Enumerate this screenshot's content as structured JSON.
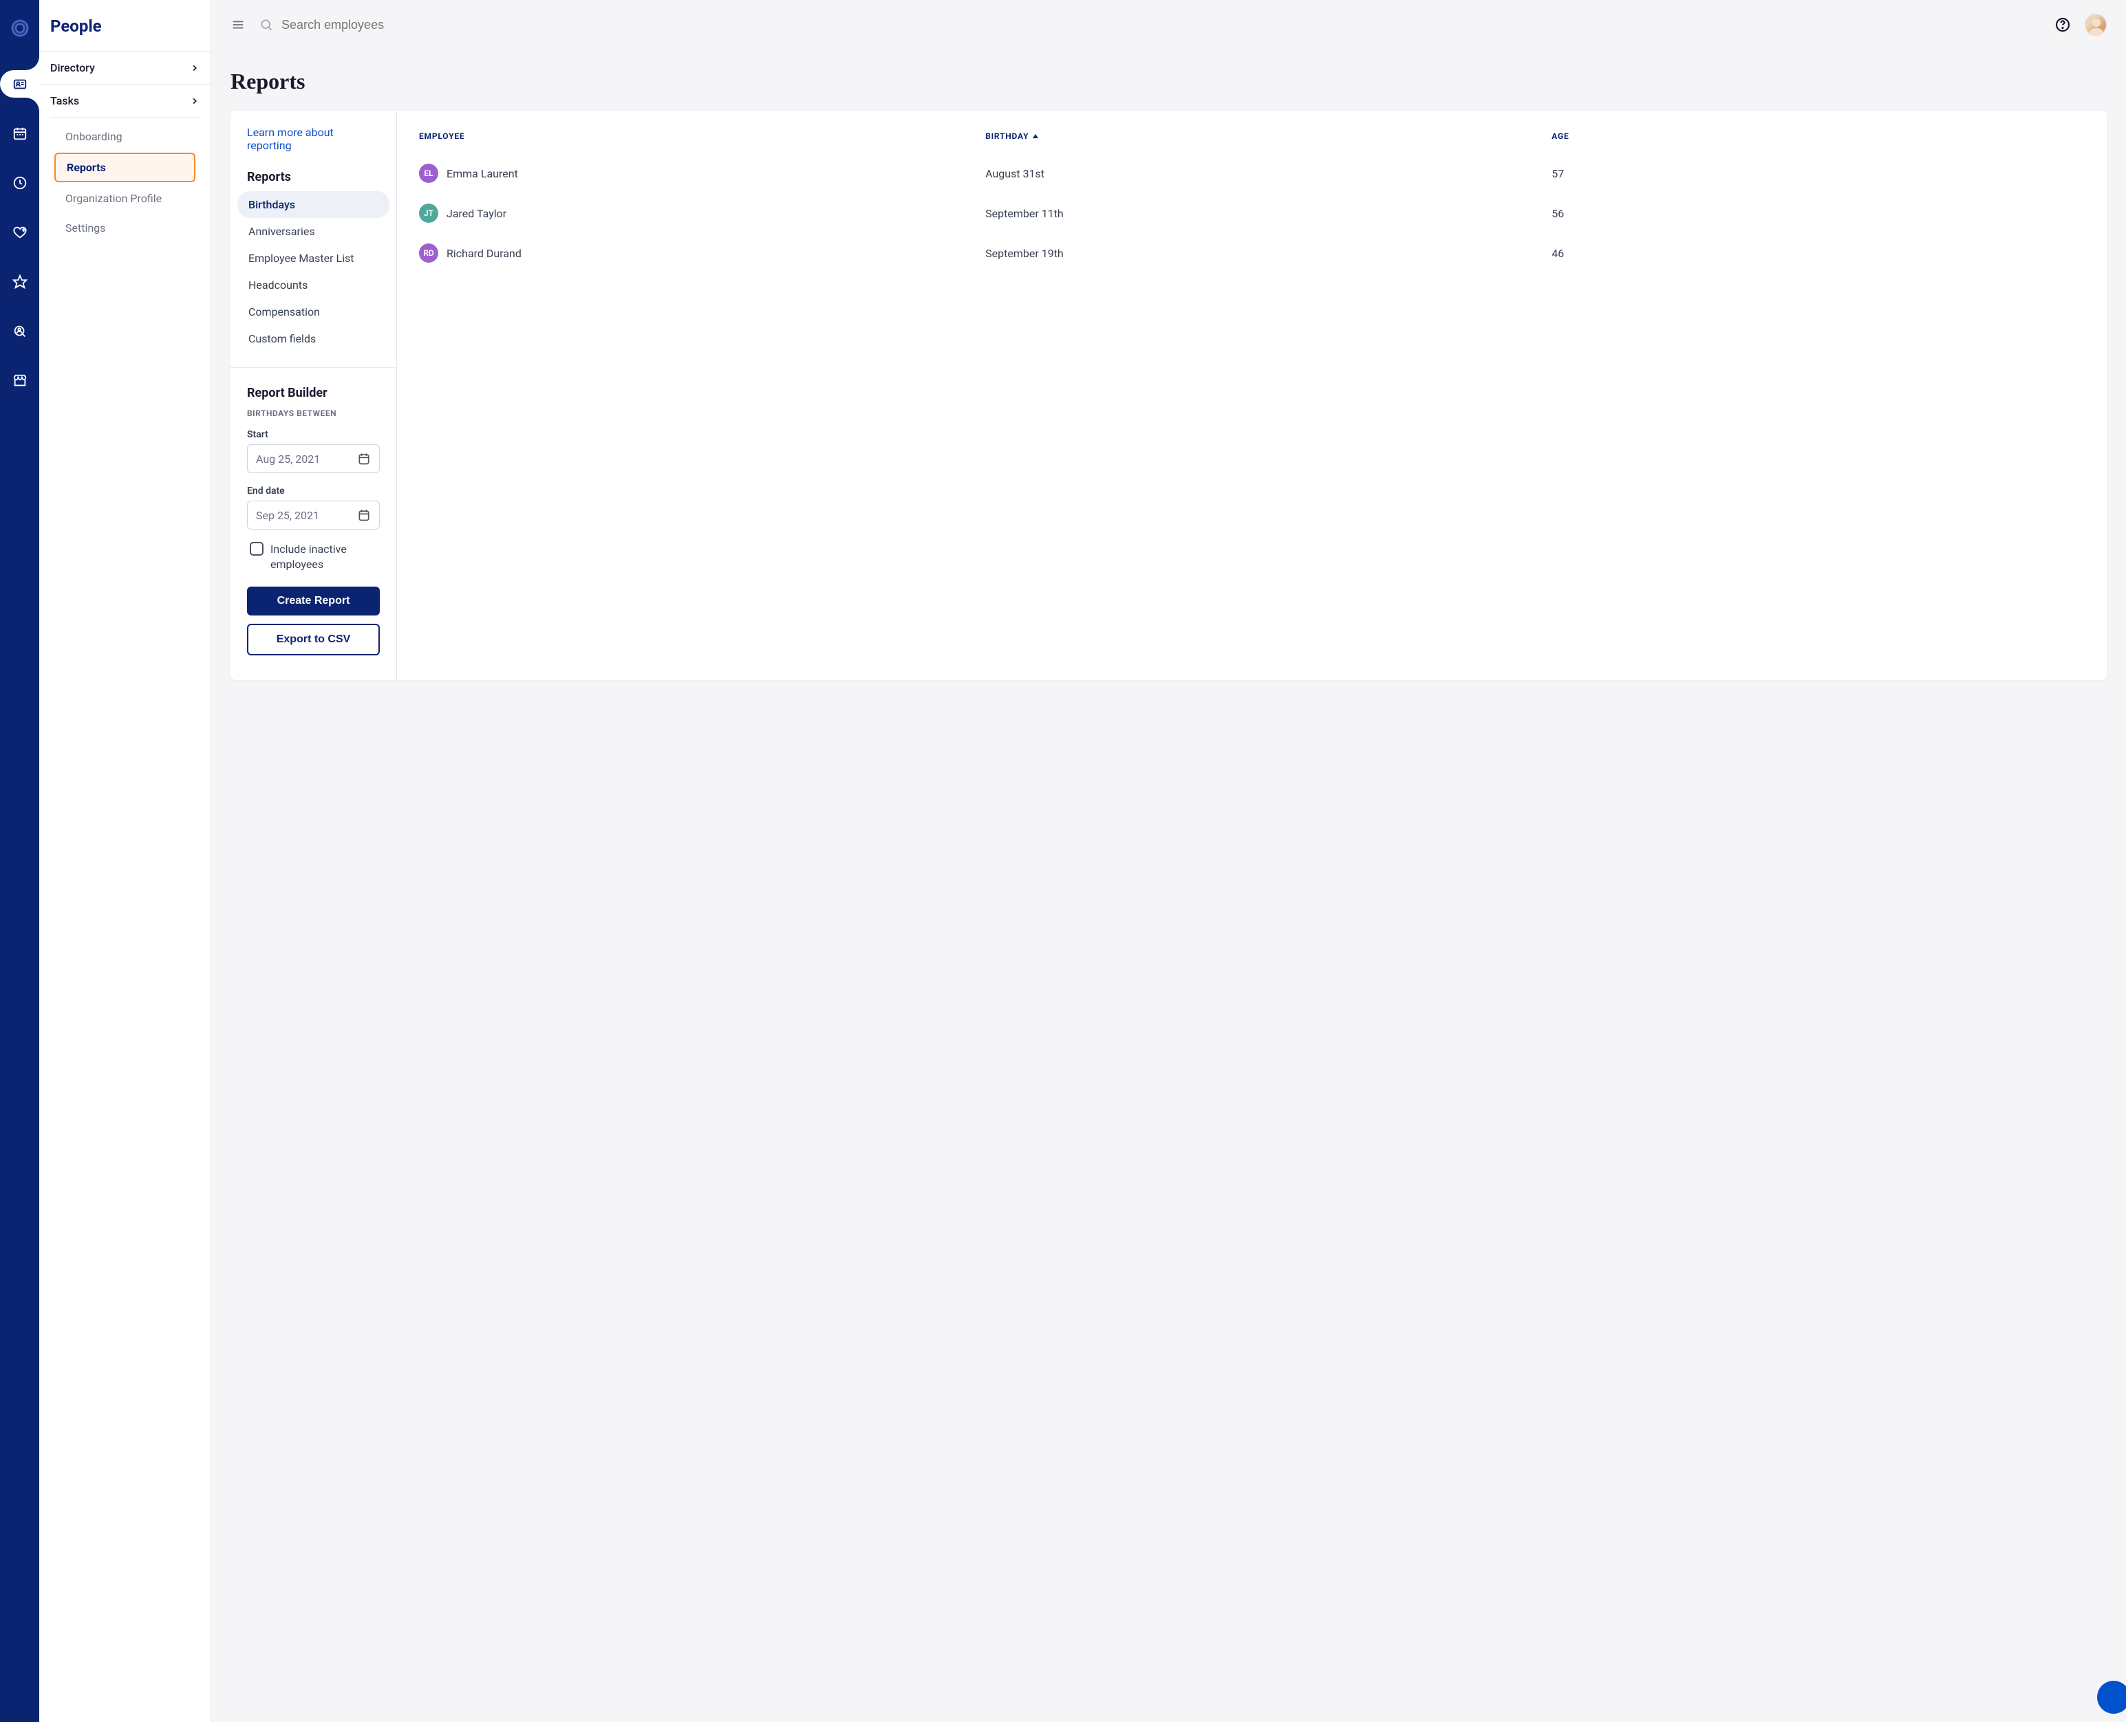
{
  "sidebar": {
    "title": "People",
    "groups": [
      {
        "label": "Directory"
      },
      {
        "label": "Tasks"
      }
    ],
    "subitems": [
      {
        "label": "Onboarding",
        "active": false
      },
      {
        "label": "Reports",
        "active": true
      },
      {
        "label": "Organization Profile",
        "active": false
      },
      {
        "label": "Settings",
        "active": false
      }
    ]
  },
  "topbar": {
    "search_placeholder": "Search employees"
  },
  "page": {
    "title": "Reports"
  },
  "reports_panel": {
    "learn_more": "Learn more about reporting",
    "heading": "Reports",
    "types": [
      "Birthdays",
      "Anniversaries",
      "Employee Master List",
      "Headcounts",
      "Compensation",
      "Custom fields"
    ]
  },
  "builder": {
    "title": "Report Builder",
    "subtitle": "BIRTHDAYS BETWEEN",
    "start_label": "Start",
    "start_value": "Aug 25, 2021",
    "end_label": "End date",
    "end_value": "Sep 25, 2021",
    "checkbox_label": "Include inactive employees",
    "create_label": "Create Report",
    "export_label": "Export to CSV"
  },
  "table": {
    "headers": {
      "employee": "EMPLOYEE",
      "birthday": "BIRTHDAY",
      "age": "AGE"
    },
    "rows": [
      {
        "initials": "EL",
        "color": "bg-purple",
        "name": "Emma Laurent",
        "birthday": "August 31st",
        "age": "57"
      },
      {
        "initials": "JT",
        "color": "bg-teal",
        "name": "Jared Taylor",
        "birthday": "September 11th",
        "age": "56"
      },
      {
        "initials": "RD",
        "color": "bg-purple2",
        "name": "Richard Durand",
        "birthday": "September 19th",
        "age": "46"
      }
    ]
  }
}
